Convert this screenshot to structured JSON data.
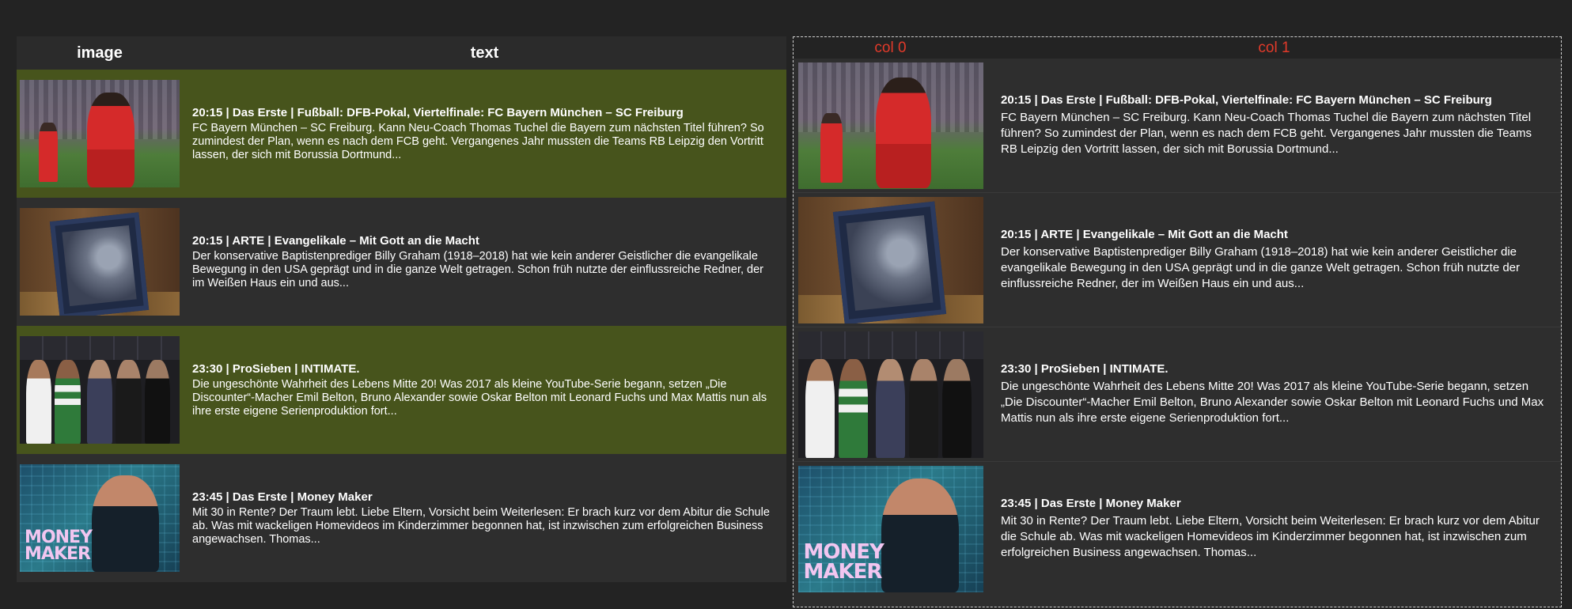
{
  "left_table": {
    "headers": {
      "image": "image",
      "text": "text"
    },
    "rows": [
      {
        "title": "20:15 | Das Erste | Fußball: DFB-Pokal, Viertelfinale: FC Bayern München – SC Freiburg",
        "desc": "FC Bayern München – SC Freiburg. Kann Neu-Coach Thomas Tuchel die Bayern zum nächsten Titel führen? So zumindest der Plan, wenn es nach dem FCB geht. Vergangenes Jahr mussten die Teams RB Leipzig den Vortritt lassen, der sich mit Borussia Dortmund...",
        "image": "football-photo",
        "highlight": true
      },
      {
        "title": "20:15 | ARTE | Evangelikale – Mit Gott an die Macht",
        "desc": "Der konservative Baptistenprediger Billy Graham (1918–2018) hat wie kein anderer Geistlicher die evangelikale Bewegung in den USA geprägt und in die ganze Welt getragen. Schon früh nutzte der einflussreiche Redner, der im Weißen Haus ein und aus...",
        "image": "framed-portrait-photo",
        "highlight": false
      },
      {
        "title": "23:30 | ProSieben | INTIMATE.",
        "desc": "Die ungeschönte Wahrheit des Lebens Mitte 20! Was 2017 als kleine YouTube-Serie begann, setzen „Die Discounter“-Macher Emil Belton, Bruno Alexander sowie Oskar Belton mit Leonard Fuchs und Max Mattis nun als ihre erste eigene Serienproduktion fort...",
        "image": "group-photo",
        "highlight": true
      },
      {
        "title": "23:45 | Das Erste | Money Maker",
        "desc": "Mit 30 in Rente? Der Traum lebt. Liebe Eltern, Vorsicht beim Weiterlesen: Er brach kurz vor dem Abitur die Schule ab. Was mit wackeligen Homevideos im Kinderzimmer begonnen hat, ist inzwischen zum erfolgreichen Business angewachsen. Thomas...",
        "image": "money-maker-photo",
        "highlight": false
      }
    ]
  },
  "right_table": {
    "headers": {
      "col0": "col 0",
      "col1": "col 1"
    },
    "rows": [
      {
        "title": "20:15 | Das Erste | Fußball: DFB-Pokal, Viertelfinale: FC Bayern München – SC Freiburg",
        "desc": "FC Bayern München – SC Freiburg. Kann Neu-Coach Thomas Tuchel die Bayern zum nächsten Titel führen? So zumindest der Plan, wenn es nach dem FCB geht. Vergangenes Jahr mussten die Teams RB Leipzig den Vortritt lassen, der sich mit Borussia Dortmund..."
      },
      {
        "title": "20:15 | ARTE | Evangelikale – Mit Gott an die Macht",
        "desc": "Der konservative Baptistenprediger Billy Graham (1918–2018) hat wie kein anderer Geistlicher die evangelikale Bewegung in den USA geprägt und in die ganze Welt getragen. Schon früh nutzte der einflussreiche Redner, der im Weißen Haus ein und aus..."
      },
      {
        "title": "23:30 | ProSieben | INTIMATE.",
        "desc": "Die ungeschönte Wahrheit des Lebens Mitte 20! Was 2017 als kleine YouTube-Serie begann, setzen „Die Discounter“-Macher Emil Belton, Bruno Alexander sowie Oskar Belton mit Leonard Fuchs und Max Mattis nun als ihre erste eigene Serienproduktion fort..."
      },
      {
        "title": "23:45 | Das Erste | Money Maker",
        "desc": "Mit 30 in Rente? Der Traum lebt. Liebe Eltern, Vorsicht beim Weiterlesen: Er brach kurz vor dem Abitur die Schule ab. Was mit wackeligen Homevideos im Kinderzimmer begonnen hat, ist inzwischen zum erfolgreichen Business angewachsen. Thomas..."
      }
    ]
  },
  "images": {
    "money_maker_logo_line1": "MONEY",
    "money_maker_logo_line2": "MAKER"
  },
  "colors": {
    "page_bg": "#232323",
    "row_highlight": "#47541c",
    "col_header_text": "#e23a2a"
  }
}
